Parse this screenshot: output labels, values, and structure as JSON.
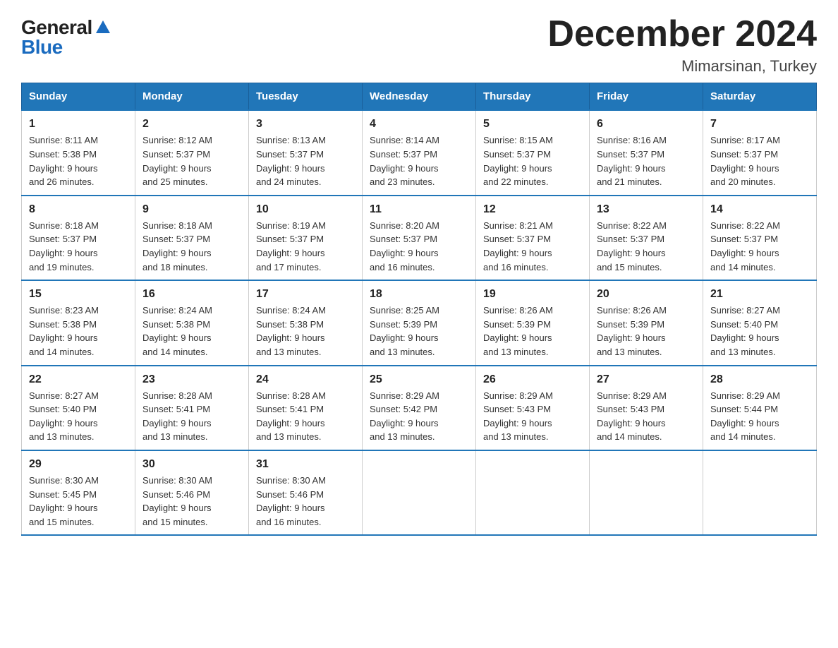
{
  "logo": {
    "general": "General",
    "blue": "Blue"
  },
  "header": {
    "month": "December 2024",
    "location": "Mimarsinan, Turkey"
  },
  "weekdays": [
    "Sunday",
    "Monday",
    "Tuesday",
    "Wednesday",
    "Thursday",
    "Friday",
    "Saturday"
  ],
  "weeks": [
    [
      {
        "day": "1",
        "sunrise": "8:11 AM",
        "sunset": "5:38 PM",
        "daylight": "9 hours and 26 minutes."
      },
      {
        "day": "2",
        "sunrise": "8:12 AM",
        "sunset": "5:37 PM",
        "daylight": "9 hours and 25 minutes."
      },
      {
        "day": "3",
        "sunrise": "8:13 AM",
        "sunset": "5:37 PM",
        "daylight": "9 hours and 24 minutes."
      },
      {
        "day": "4",
        "sunrise": "8:14 AM",
        "sunset": "5:37 PM",
        "daylight": "9 hours and 23 minutes."
      },
      {
        "day": "5",
        "sunrise": "8:15 AM",
        "sunset": "5:37 PM",
        "daylight": "9 hours and 22 minutes."
      },
      {
        "day": "6",
        "sunrise": "8:16 AM",
        "sunset": "5:37 PM",
        "daylight": "9 hours and 21 minutes."
      },
      {
        "day": "7",
        "sunrise": "8:17 AM",
        "sunset": "5:37 PM",
        "daylight": "9 hours and 20 minutes."
      }
    ],
    [
      {
        "day": "8",
        "sunrise": "8:18 AM",
        "sunset": "5:37 PM",
        "daylight": "9 hours and 19 minutes."
      },
      {
        "day": "9",
        "sunrise": "8:18 AM",
        "sunset": "5:37 PM",
        "daylight": "9 hours and 18 minutes."
      },
      {
        "day": "10",
        "sunrise": "8:19 AM",
        "sunset": "5:37 PM",
        "daylight": "9 hours and 17 minutes."
      },
      {
        "day": "11",
        "sunrise": "8:20 AM",
        "sunset": "5:37 PM",
        "daylight": "9 hours and 16 minutes."
      },
      {
        "day": "12",
        "sunrise": "8:21 AM",
        "sunset": "5:37 PM",
        "daylight": "9 hours and 16 minutes."
      },
      {
        "day": "13",
        "sunrise": "8:22 AM",
        "sunset": "5:37 PM",
        "daylight": "9 hours and 15 minutes."
      },
      {
        "day": "14",
        "sunrise": "8:22 AM",
        "sunset": "5:37 PM",
        "daylight": "9 hours and 14 minutes."
      }
    ],
    [
      {
        "day": "15",
        "sunrise": "8:23 AM",
        "sunset": "5:38 PM",
        "daylight": "9 hours and 14 minutes."
      },
      {
        "day": "16",
        "sunrise": "8:24 AM",
        "sunset": "5:38 PM",
        "daylight": "9 hours and 14 minutes."
      },
      {
        "day": "17",
        "sunrise": "8:24 AM",
        "sunset": "5:38 PM",
        "daylight": "9 hours and 13 minutes."
      },
      {
        "day": "18",
        "sunrise": "8:25 AM",
        "sunset": "5:39 PM",
        "daylight": "9 hours and 13 minutes."
      },
      {
        "day": "19",
        "sunrise": "8:26 AM",
        "sunset": "5:39 PM",
        "daylight": "9 hours and 13 minutes."
      },
      {
        "day": "20",
        "sunrise": "8:26 AM",
        "sunset": "5:39 PM",
        "daylight": "9 hours and 13 minutes."
      },
      {
        "day": "21",
        "sunrise": "8:27 AM",
        "sunset": "5:40 PM",
        "daylight": "9 hours and 13 minutes."
      }
    ],
    [
      {
        "day": "22",
        "sunrise": "8:27 AM",
        "sunset": "5:40 PM",
        "daylight": "9 hours and 13 minutes."
      },
      {
        "day": "23",
        "sunrise": "8:28 AM",
        "sunset": "5:41 PM",
        "daylight": "9 hours and 13 minutes."
      },
      {
        "day": "24",
        "sunrise": "8:28 AM",
        "sunset": "5:41 PM",
        "daylight": "9 hours and 13 minutes."
      },
      {
        "day": "25",
        "sunrise": "8:29 AM",
        "sunset": "5:42 PM",
        "daylight": "9 hours and 13 minutes."
      },
      {
        "day": "26",
        "sunrise": "8:29 AM",
        "sunset": "5:43 PM",
        "daylight": "9 hours and 13 minutes."
      },
      {
        "day": "27",
        "sunrise": "8:29 AM",
        "sunset": "5:43 PM",
        "daylight": "9 hours and 14 minutes."
      },
      {
        "day": "28",
        "sunrise": "8:29 AM",
        "sunset": "5:44 PM",
        "daylight": "9 hours and 14 minutes."
      }
    ],
    [
      {
        "day": "29",
        "sunrise": "8:30 AM",
        "sunset": "5:45 PM",
        "daylight": "9 hours and 15 minutes."
      },
      {
        "day": "30",
        "sunrise": "8:30 AM",
        "sunset": "5:46 PM",
        "daylight": "9 hours and 15 minutes."
      },
      {
        "day": "31",
        "sunrise": "8:30 AM",
        "sunset": "5:46 PM",
        "daylight": "9 hours and 16 minutes."
      },
      null,
      null,
      null,
      null
    ]
  ]
}
